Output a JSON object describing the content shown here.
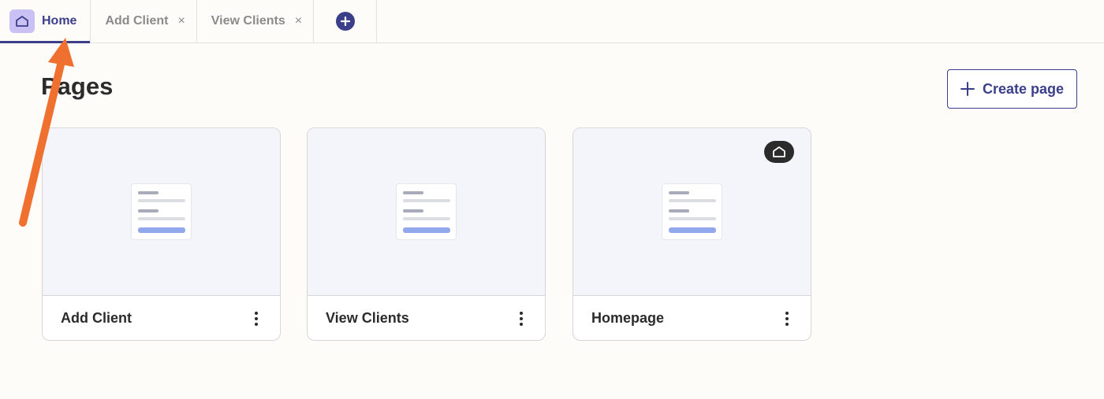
{
  "tabs": [
    {
      "label": "Home",
      "icon": "home-icon",
      "active": true
    },
    {
      "label": "Add Client",
      "closable": true,
      "close_glyph": "×"
    },
    {
      "label": "View Clients",
      "closable": true,
      "close_glyph": "×"
    }
  ],
  "add_tab_icon": "plus-circle-icon",
  "main": {
    "title": "Pages",
    "create_button": "Create page"
  },
  "cards": [
    {
      "name": "Add Client",
      "is_home": false
    },
    {
      "name": "View Clients",
      "is_home": false
    },
    {
      "name": "Homepage",
      "is_home": true
    }
  ],
  "colors": {
    "accent": "#3b3f8a",
    "home_badge": "#c9c1f3",
    "annotation_arrow": "#f07030",
    "preview_bg": "#f4f5fb",
    "doc_bar": "#92a8ec"
  }
}
